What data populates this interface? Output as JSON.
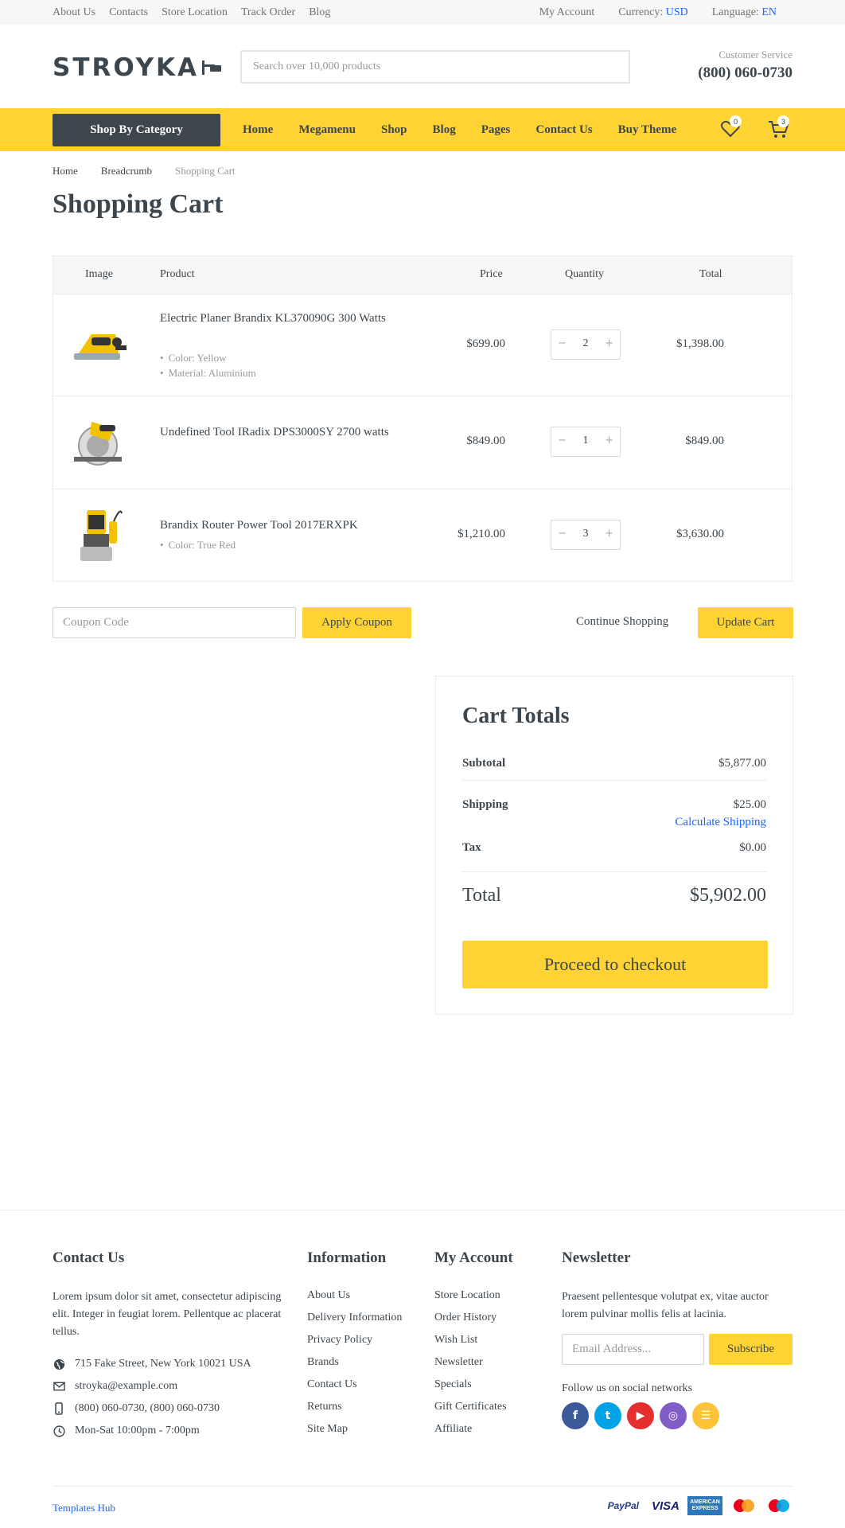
{
  "topbar": {
    "links": [
      "About Us",
      "Contacts",
      "Store Location",
      "Track Order",
      "Blog"
    ],
    "my_account": "My Account",
    "currency_label": "Currency:",
    "currency_value": "USD",
    "language_label": "Language:",
    "language_value": "EN"
  },
  "header": {
    "logo": "STROYKA",
    "search_placeholder": "Search over 10,000 products",
    "customer_service_label": "Customer Service",
    "phone": "(800) 060-0730"
  },
  "nav": {
    "category_button": "Shop By Category",
    "links": [
      "Home",
      "Megamenu",
      "Shop",
      "Blog",
      "Pages",
      "Contact Us",
      "Buy Theme"
    ],
    "wishlist_count": "0",
    "cart_count": "3"
  },
  "breadcrumb": [
    "Home",
    "Breadcrumb",
    "Shopping Cart"
  ],
  "page_title": "Shopping Cart",
  "cart": {
    "headers": {
      "image": "Image",
      "product": "Product",
      "price": "Price",
      "quantity": "Quantity",
      "total": "Total"
    },
    "items": [
      {
        "name": "Electric Planer Brandix KL370090G 300 Watts",
        "options": [
          "Color: Yellow",
          "Material: Aluminium"
        ],
        "price": "$699.00",
        "quantity": "2",
        "total": "$1,398.00",
        "image_icon": "planer-image"
      },
      {
        "name": "Undefined Tool IRadix DPS3000SY 2700 watts",
        "options": [],
        "price": "$849.00",
        "quantity": "1",
        "total": "$849.00",
        "image_icon": "circular-saw-image"
      },
      {
        "name": "Brandix Router Power Tool 2017ERXPK",
        "options": [
          "Color: True Red"
        ],
        "price": "$1,210.00",
        "quantity": "3",
        "total": "$3,630.00",
        "image_icon": "router-image"
      }
    ],
    "qty_minus": "−",
    "qty_plus": "+"
  },
  "actions": {
    "coupon_placeholder": "Coupon Code",
    "apply_coupon": "Apply Coupon",
    "continue_shopping": "Continue Shopping",
    "update_cart": "Update Cart"
  },
  "totals": {
    "title": "Cart Totals",
    "subtotal_label": "Subtotal",
    "subtotal": "$5,877.00",
    "shipping_label": "Shipping",
    "shipping": "$25.00",
    "calculate_shipping": "Calculate Shipping",
    "tax_label": "Tax",
    "tax": "$0.00",
    "total_label": "Total",
    "total": "$5,902.00",
    "checkout": "Proceed to checkout"
  },
  "footer": {
    "contact": {
      "title": "Contact Us",
      "text": "Lorem ipsum dolor sit amet, consectetur adipiscing elit. Integer in feugiat lorem. Pellentque ac placerat tellus.",
      "address": "715 Fake Street, New York 10021 USA",
      "email": "stroyka@example.com",
      "phone": "(800) 060-0730, (800) 060-0730",
      "hours": "Mon-Sat 10:00pm - 7:00pm"
    },
    "information": {
      "title": "Information",
      "links": [
        "About Us",
        "Delivery Information",
        "Privacy Policy",
        "Brands",
        "Contact Us",
        "Returns",
        "Site Map"
      ]
    },
    "my_account": {
      "title": "My Account",
      "links": [
        "Store Location",
        "Order History",
        "Wish List",
        "Newsletter",
        "Specials",
        "Gift Certificates",
        "Affiliate"
      ]
    },
    "newsletter": {
      "title": "Newsletter",
      "text": "Praesent pellentesque volutpat ex, vitae auctor lorem pulvinar mollis felis at lacinia.",
      "email_placeholder": "Email Address...",
      "subscribe": "Subscribe",
      "follow": "Follow us on social networks",
      "socials": [
        {
          "name": "facebook-icon",
          "color": "#3c5a99",
          "glyph": "f"
        },
        {
          "name": "twitter-icon",
          "color": "#00a2e8",
          "glyph": "t"
        },
        {
          "name": "youtube-icon",
          "color": "#e52e2e",
          "glyph": "▶"
        },
        {
          "name": "instagram-icon",
          "color": "#815dc7",
          "glyph": "◎"
        },
        {
          "name": "rss-icon",
          "color": "#ffc338",
          "glyph": "☰"
        }
      ]
    },
    "copyright": "Templates Hub",
    "payments": {
      "paypal": "PayPal",
      "visa": "VISA",
      "amex_line1": "AMERICAN",
      "amex_line2": "EXPRESS"
    }
  },
  "colors": {
    "accent": "#ffd333",
    "dark": "#3d464d",
    "link": "#1a66ff"
  }
}
